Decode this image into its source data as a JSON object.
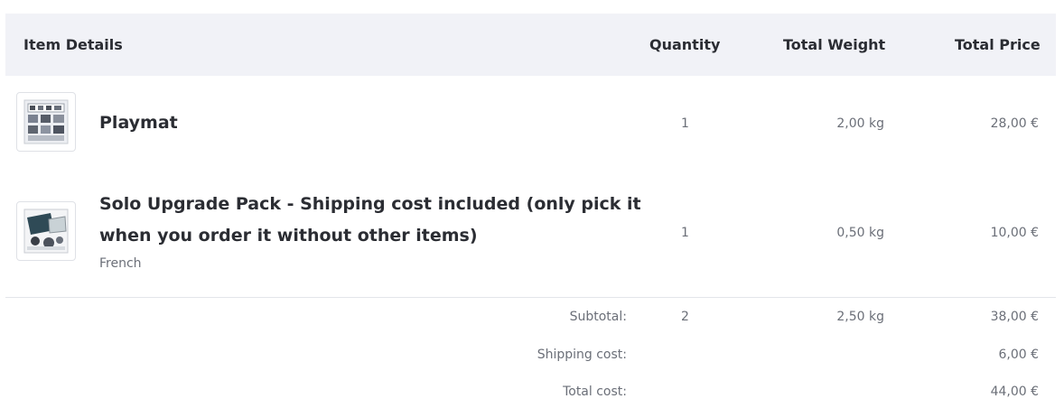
{
  "table": {
    "headers": {
      "item_details": "Item Details",
      "quantity": "Quantity",
      "total_weight": "Total Weight",
      "total_price": "Total Price"
    },
    "items": [
      {
        "name": "Playmat",
        "variant": "",
        "quantity": "1",
        "weight": "2,00 kg",
        "price": "28,00 €",
        "thumbnail": "playmat-image"
      },
      {
        "name": "Solo Upgrade Pack - Shipping cost included (only pick it when you order it without other items)",
        "variant": "French",
        "quantity": "1",
        "weight": "0,50 kg",
        "price": "10,00 €",
        "thumbnail": "solo-upgrade-pack-image"
      }
    ]
  },
  "summary": {
    "subtotal_label": "Subtotal:",
    "subtotal_quantity": "2",
    "subtotal_weight": "2,50 kg",
    "subtotal_price": "38,00 €",
    "shipping_label": "Shipping cost:",
    "shipping_price": "6,00 €",
    "total_label": "Total cost:",
    "total_price": "44,00 €"
  }
}
